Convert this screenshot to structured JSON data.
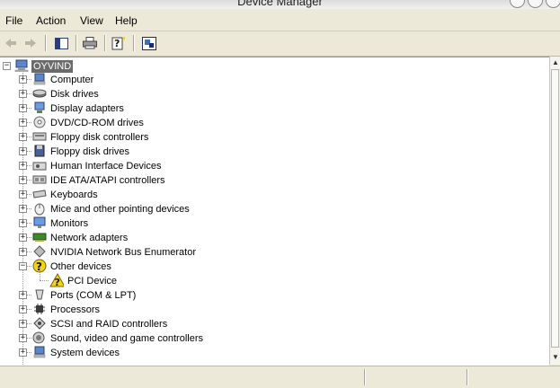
{
  "window": {
    "title": "Device Manager"
  },
  "menu": {
    "items": [
      "File",
      "Action",
      "View",
      "Help"
    ]
  },
  "toolbar": {
    "buttons": [
      "back-icon",
      "forward-icon",
      "show-hide-tree-icon",
      "print-icon",
      "help-icon",
      "properties-icon"
    ]
  },
  "tree": {
    "root": {
      "label": "OYVIND",
      "expanded": true,
      "selected": true,
      "icon": "computer-icon"
    },
    "items": [
      {
        "label": "Computer",
        "icon": "computer-icon",
        "expanded": false
      },
      {
        "label": "Disk drives",
        "icon": "disk-drive-icon",
        "expanded": false
      },
      {
        "label": "Display adapters",
        "icon": "display-adapter-icon",
        "expanded": false
      },
      {
        "label": "DVD/CD-ROM drives",
        "icon": "cdrom-icon",
        "expanded": false
      },
      {
        "label": "Floppy disk controllers",
        "icon": "floppy-controller-icon",
        "expanded": false
      },
      {
        "label": "Floppy disk drives",
        "icon": "floppy-drive-icon",
        "expanded": false
      },
      {
        "label": "Human Interface Devices",
        "icon": "hid-icon",
        "expanded": false
      },
      {
        "label": "IDE ATA/ATAPI controllers",
        "icon": "ide-controller-icon",
        "expanded": false
      },
      {
        "label": "Keyboards",
        "icon": "keyboard-icon",
        "expanded": false
      },
      {
        "label": "Mice and other pointing devices",
        "icon": "mouse-icon",
        "expanded": false
      },
      {
        "label": "Monitors",
        "icon": "monitor-icon",
        "expanded": false
      },
      {
        "label": "Network adapters",
        "icon": "network-adapter-icon",
        "expanded": false
      },
      {
        "label": "NVIDIA Network Bus Enumerator",
        "icon": "bus-enumerator-icon",
        "expanded": false
      },
      {
        "label": "Other devices",
        "icon": "unknown-device-icon",
        "expanded": true,
        "children": [
          {
            "label": "PCI Device",
            "icon": "warning-device-icon"
          }
        ]
      },
      {
        "label": "Ports (COM & LPT)",
        "icon": "port-icon",
        "expanded": false
      },
      {
        "label": "Processors",
        "icon": "processor-icon",
        "expanded": false
      },
      {
        "label": "SCSI and RAID controllers",
        "icon": "scsi-icon",
        "expanded": false
      },
      {
        "label": "Sound, video and game controllers",
        "icon": "sound-icon",
        "expanded": false
      },
      {
        "label": "System devices",
        "icon": "system-device-icon",
        "expanded": false
      }
    ]
  },
  "colors": {
    "selection": "#6b6b6b",
    "accent": "#3a6fc2",
    "warning": "#f2d21a"
  }
}
